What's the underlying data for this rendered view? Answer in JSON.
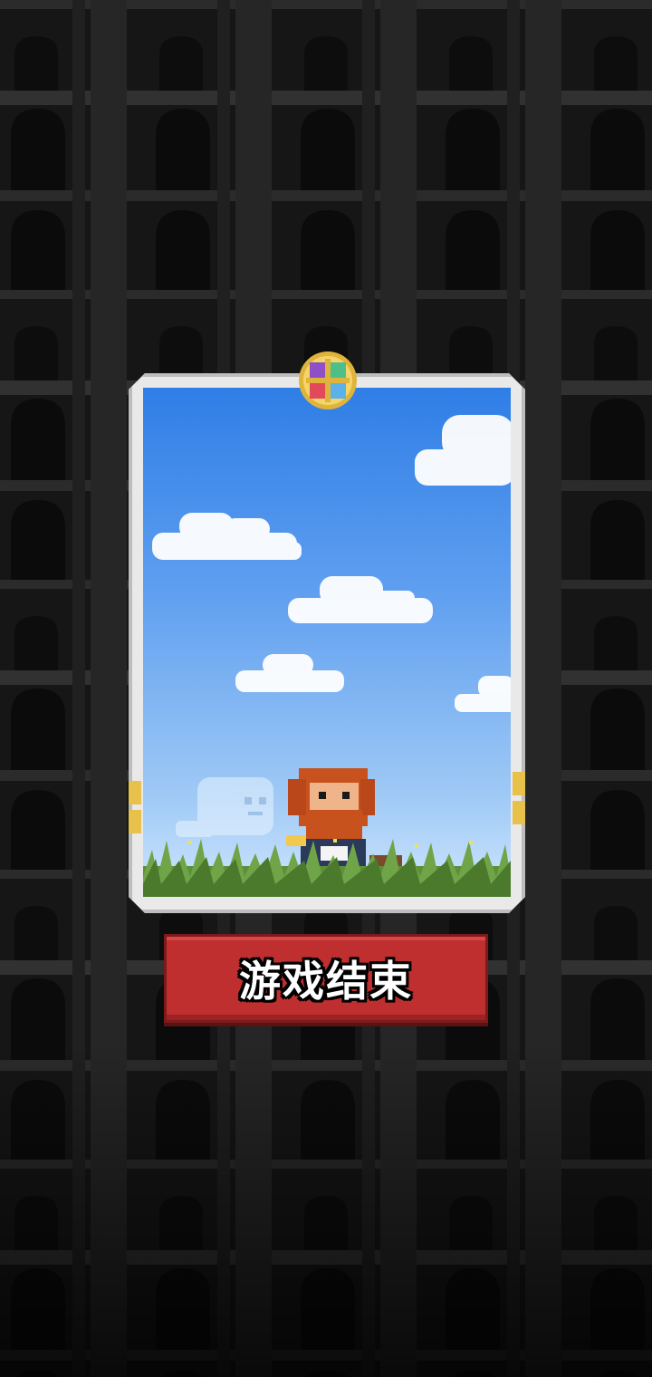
{
  "screen": {
    "title": "游戏结束",
    "end_button_label": "游戏结束"
  },
  "icons": {
    "emblem": "four-gem-emblem-icon",
    "character": "bearded-hero-sprite",
    "ghost": "ghost-sprite"
  },
  "colors": {
    "button_red": "#bf2f2f",
    "card_frame": "#e9e9e9",
    "sky_blue": "#5f9ff0",
    "background": "#1f1f1f"
  }
}
